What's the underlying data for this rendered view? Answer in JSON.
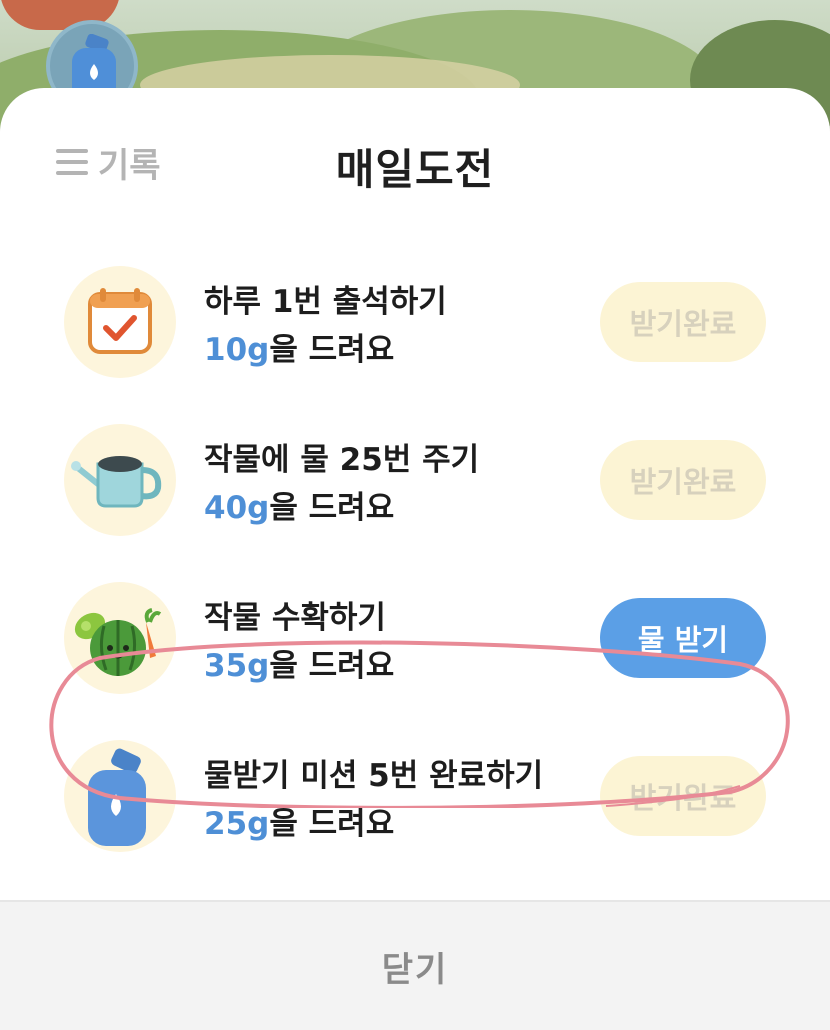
{
  "header": {
    "history_label": "기록",
    "title": "매일도전"
  },
  "tasks": [
    {
      "icon": "calendar-icon",
      "title": "하루 1번 출석하기",
      "reward_amount": "10g",
      "reward_suffix": "을 드려요",
      "button": "받기완료",
      "state": "done"
    },
    {
      "icon": "watering-can-icon",
      "title": "작물에 물 25번 주기",
      "reward_amount": "40g",
      "reward_suffix": "을 드려요",
      "button": "받기완료",
      "state": "done"
    },
    {
      "icon": "vegetables-icon",
      "title": "작물 수확하기",
      "reward_amount": "35g",
      "reward_suffix": "을 드려요",
      "button": "물 받기",
      "state": "active"
    },
    {
      "icon": "water-bottle-icon",
      "title": "물받기 미션 5번 완료하기",
      "reward_amount": "25g",
      "reward_suffix": "을 드려요",
      "button": "받기완료",
      "state": "done"
    }
  ],
  "footer": {
    "close_label": "닫기"
  },
  "colors": {
    "accent_blue": "#5b9fe6",
    "reward_blue": "#4e8fd6",
    "done_button_bg": "#fcf4d4",
    "highlight_red": "#e88a96"
  }
}
